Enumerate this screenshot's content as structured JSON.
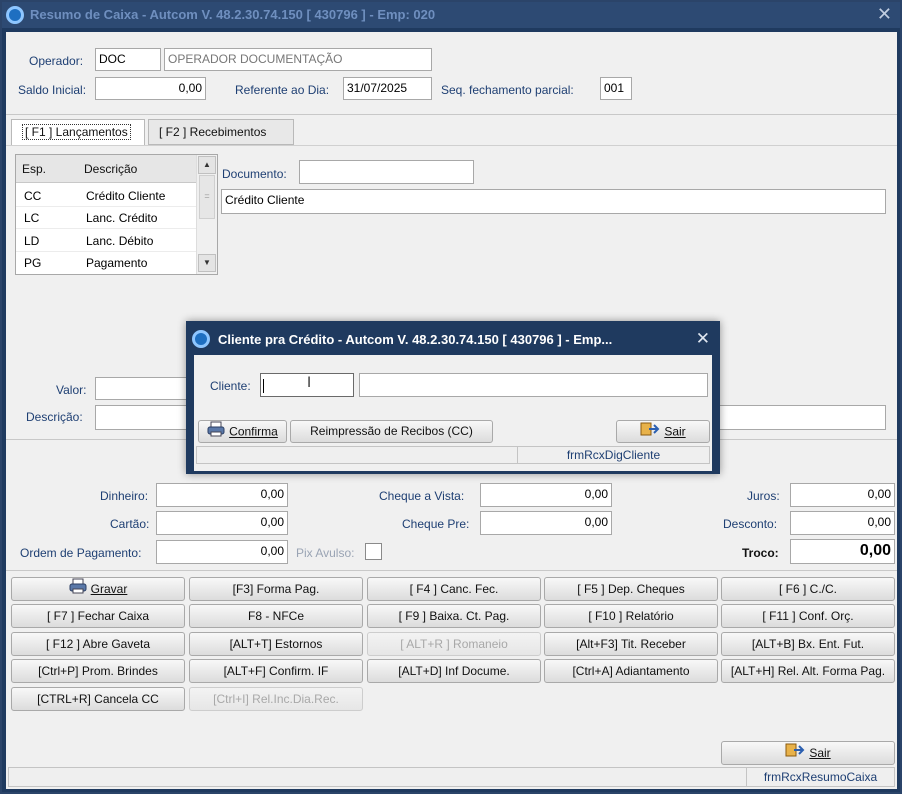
{
  "window": {
    "title": "Resumo de Caixa   -   Autcom V. 48.2.30.74.150 [ 430796 ] - Emp: 020",
    "close_glyph": "✕"
  },
  "header": {
    "operador_label": "Operador:",
    "operador_code": "DOC",
    "operador_name": "OPERADOR DOCUMENTAÇÃO",
    "saldo_label": "Saldo Inicial:",
    "saldo_value": "0,00",
    "referente_label": "Referente ao Dia:",
    "referente_value": "31/07/2025",
    "seq_label": "Seq. fechamento parcial:",
    "seq_value": "001"
  },
  "tabs": [
    {
      "label": "[ F1 ] Lançamentos",
      "active": true
    },
    {
      "label": "[ F2 ] Recebimentos",
      "active": false
    }
  ],
  "grid": {
    "columns": [
      "Esp.",
      "Descrição"
    ],
    "rows": [
      {
        "esp": "CC",
        "desc": "Crédito Cliente"
      },
      {
        "esp": "LC",
        "desc": "Lanc. Crédito"
      },
      {
        "esp": "LD",
        "desc": "Lanc. Débito"
      },
      {
        "esp": "PG",
        "desc": "Pagamento"
      }
    ]
  },
  "lancamento": {
    "documento_label": "Documento:",
    "documento_value": "",
    "tipo_value": "Crédito Cliente",
    "valor_label": "Valor:",
    "descricao_label": "Descrição:"
  },
  "totals": {
    "dinheiro_label": "Dinheiro:",
    "dinheiro_value": "0,00",
    "cartao_label": "Cartão:",
    "cartao_value": "0,00",
    "ordem_label": "Ordem de Pagamento:",
    "ordem_value": "0,00",
    "pix_label": "Pix Avulso:",
    "cheque_vista_label": "Cheque a Vista:",
    "cheque_vista_value": "0,00",
    "cheque_pre_label": "Cheque Pre:",
    "cheque_pre_value": "0,00",
    "juros_label": "Juros:",
    "juros_value": "0,00",
    "desconto_label": "Desconto:",
    "desconto_value": "0,00",
    "troco_label": "Troco:",
    "troco_value": "0,00"
  },
  "buttons": {
    "gravar": "Gravar",
    "forma_pag": "[F3] Forma Pag.",
    "canc_fec": "[ F4 ] Canc. Fec.",
    "dep_cheques": "[ F5 ] Dep. Cheques",
    "cc": "[ F6 ] C./C.",
    "fechar_caixa": "[ F7 ] Fechar Caixa",
    "nfce": "F8 - NFCe",
    "baixa_ct_pag": "[ F9 ] Baixa. Ct. Pag.",
    "relatorio": "[ F10 ] Relatório",
    "conf_orc": "[ F11 ] Conf. Orç.",
    "abre_gaveta": "[ F12 ] Abre Gaveta",
    "estornos": "[ALT+T] Estornos",
    "romaneio": "[ ALT+R ] Romaneio",
    "tit_receber": "[Alt+F3] Tit. Receber",
    "bx_ent_fut": "[ALT+B] Bx. Ent. Fut.",
    "prom_brindes": "[Ctrl+P] Prom. Brindes",
    "confirm_if": "[ALT+F] Confirm. IF",
    "inf_docume": "[ALT+D] Inf Docume.",
    "adiantamento": "[Ctrl+A] Adiantamento",
    "rel_alt_forma": "[ALT+H] Rel. Alt. Forma Pag.",
    "cancela_cc": "[CTRL+R] Cancela CC",
    "rel_inc_dia": "[Ctrl+I] Rel.Inc.Dia.Rec.",
    "sair": "Sair"
  },
  "status": {
    "form_name": "frmRcxResumoCaixa"
  },
  "dialog": {
    "title": "Cliente pra Crédito   -   Autcom V. 48.2.30.74.150 [ 430796 ] - Emp...",
    "close_glyph": "✕",
    "cliente_label": "Cliente:",
    "cliente_code": "",
    "cliente_name": "",
    "confirma": "Confirma",
    "reimpressao": "Reimpressão de Recibos (CC)",
    "sair": "Sair",
    "form_name": "frmRcxDigCliente"
  },
  "colors": {
    "title_bar": "#2d4a73",
    "label_blue": "#1e3f73",
    "window_bg": "#f0f0f0"
  },
  "icons": {
    "app": "autcom-app-icon",
    "printer": "printer-icon",
    "exit": "exit-icon"
  }
}
